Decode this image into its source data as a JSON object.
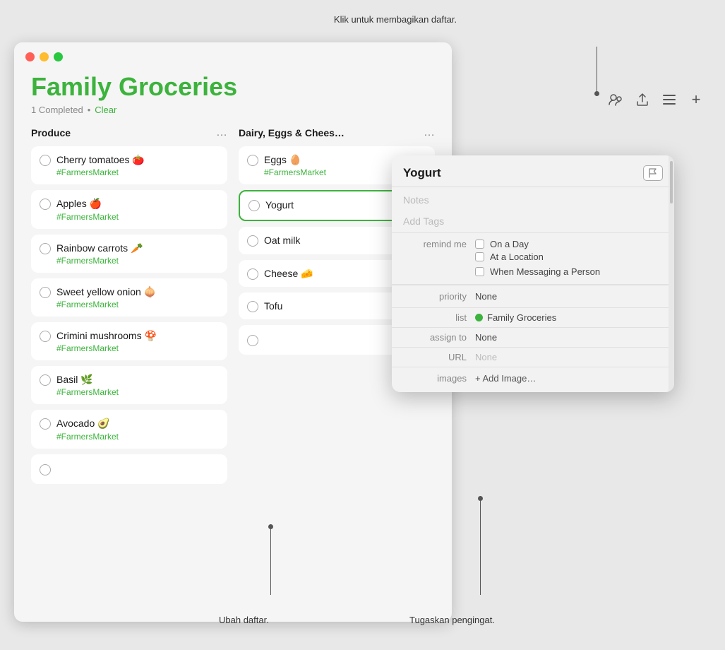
{
  "callout_top": "Klik untuk membagikan daftar.",
  "callout_bottom_left": "Ubah daftar.",
  "callout_bottom_right": "Tugaskan pengingat.",
  "toolbar": {
    "collaborate_icon": "👤",
    "share_icon": "⬆",
    "list_icon": "≡",
    "add_icon": "+"
  },
  "app": {
    "title": "Family Groceries",
    "completed_text": "1 Completed",
    "separator": "•",
    "clear_label": "Clear"
  },
  "columns": [
    {
      "id": "produce",
      "title": "Produce",
      "items": [
        {
          "name": "Cherry tomatoes 🍅",
          "tag": "#FarmersMarket",
          "selected": false
        },
        {
          "name": "Apples 🍎",
          "tag": "#FarmersMarket",
          "selected": false
        },
        {
          "name": "Rainbow carrots 🥕",
          "tag": "#FarmersMarket",
          "selected": false
        },
        {
          "name": "Sweet yellow onion 🧅",
          "tag": "#FarmersMarket",
          "selected": false
        },
        {
          "name": "Crimini mushrooms 🍄",
          "tag": "#FarmersMarket",
          "selected": false
        },
        {
          "name": "Basil 🌿",
          "tag": "#FarmersMarket",
          "selected": false
        },
        {
          "name": "Avocado 🥑",
          "tag": "#FarmersMarket",
          "selected": false
        }
      ]
    },
    {
      "id": "dairy",
      "title": "Dairy, Eggs & Chees…",
      "items": [
        {
          "name": "Eggs 🥚",
          "tag": "#FarmersMarket",
          "selected": false
        },
        {
          "name": "Yogurt",
          "tag": "",
          "selected": true
        },
        {
          "name": "Oat milk",
          "tag": "",
          "selected": false
        },
        {
          "name": "Cheese 🧀",
          "tag": "",
          "selected": false
        },
        {
          "name": "Tofu",
          "tag": "",
          "selected": false
        }
      ]
    }
  ],
  "detail_panel": {
    "title": "Yogurt",
    "flag_label": "🚩",
    "notes_placeholder": "Notes",
    "tags_placeholder": "Add Tags",
    "remind_me_label": "remind me",
    "on_a_day_label": "On a Day",
    "at_location_label": "At a Location",
    "when_messaging_label": "When Messaging a Person",
    "priority_label": "priority",
    "priority_value": "None",
    "list_label": "list",
    "list_name": "Family Groceries",
    "assign_label": "assign to",
    "assign_value": "None",
    "url_label": "URL",
    "url_value": "None",
    "images_label": "images",
    "add_image_label": "+ Add Image…"
  }
}
